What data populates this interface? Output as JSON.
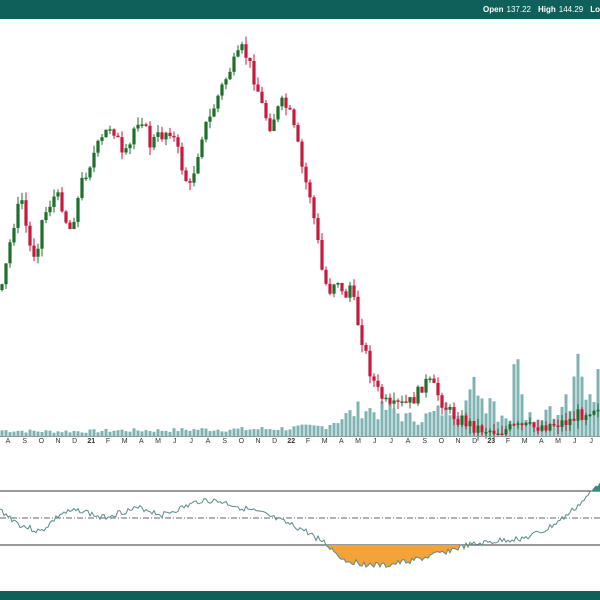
{
  "ohlc": {
    "open_label": "Open",
    "open_value": "137.22",
    "high_label": "High",
    "high_value": "144.29",
    "low_label": "Lo"
  },
  "colors": {
    "frame": "#0f5f5a",
    "up_candle": "#1e6f2a",
    "down_candle": "#c8193c",
    "volume": "#7fb3b3",
    "oscillator_line": "#5a8a8a",
    "overbought_fill": "#2f8c7e",
    "oversold_fill": "#f2a33a"
  },
  "chart_data": [
    {
      "type": "candlestick",
      "name": "price",
      "x_ticks": [
        "A",
        "S",
        "O",
        "N",
        "D",
        "21",
        "F",
        "M",
        "A",
        "M",
        "J",
        "J",
        "A",
        "S",
        "O",
        "N",
        "D",
        "22",
        "F",
        "M",
        "A",
        "M",
        "J",
        "J",
        "A",
        "S",
        "O",
        "N",
        "D",
        "23",
        "F",
        "M",
        "A",
        "M",
        "J",
        "J"
      ],
      "close_path": [
        [
          0,
          290
        ],
        [
          1,
          250
        ],
        [
          2,
          215
        ],
        [
          3,
          200
        ],
        [
          4,
          245
        ],
        [
          5,
          255
        ],
        [
          6,
          220
        ],
        [
          7,
          205
        ],
        [
          8,
          195
        ],
        [
          9,
          205
        ],
        [
          10,
          232
        ],
        [
          11,
          210
        ],
        [
          12,
          180
        ],
        [
          13,
          165
        ],
        [
          14,
          150
        ],
        [
          15,
          140
        ],
        [
          16,
          125
        ],
        [
          17,
          132
        ],
        [
          18,
          160
        ],
        [
          19,
          150
        ],
        [
          20,
          120
        ],
        [
          21,
          118
        ],
        [
          22,
          145
        ],
        [
          23,
          138
        ],
        [
          24,
          135
        ],
        [
          25,
          128
        ],
        [
          26,
          145
        ],
        [
          27,
          170
        ],
        [
          28,
          190
        ],
        [
          29,
          160
        ],
        [
          30,
          130
        ],
        [
          31,
          120
        ],
        [
          32,
          100
        ],
        [
          33,
          85
        ],
        [
          34,
          70
        ],
        [
          35,
          60
        ],
        [
          36,
          48
        ],
        [
          37,
          65
        ],
        [
          38,
          85
        ],
        [
          39,
          110
        ],
        [
          40,
          125
        ],
        [
          41,
          112
        ],
        [
          42,
          102
        ],
        [
          43,
          115
        ],
        [
          44,
          140
        ],
        [
          45,
          175
        ],
        [
          46,
          195
        ],
        [
          47,
          235
        ],
        [
          48,
          280
        ],
        [
          49,
          290
        ],
        [
          50,
          275
        ],
        [
          51,
          300
        ],
        [
          52,
          285
        ],
        [
          53,
          318
        ],
        [
          54,
          345
        ],
        [
          55,
          372
        ],
        [
          56,
          390
        ],
        [
          57,
          400
        ],
        [
          58,
          410
        ],
        [
          59,
          405
        ],
        [
          60,
          405
        ],
        [
          61,
          402
        ],
        [
          62,
          395
        ],
        [
          63,
          382
        ],
        [
          64,
          384
        ],
        [
          65,
          393
        ],
        [
          66,
          405
        ],
        [
          67,
          413
        ],
        [
          68,
          418
        ],
        [
          69,
          421
        ],
        [
          70,
          425
        ],
        [
          71,
          428
        ],
        [
          72,
          429
        ],
        [
          73,
          430
        ],
        [
          74,
          431
        ],
        [
          75,
          430
        ],
        [
          76,
          429
        ],
        [
          77,
          428
        ],
        [
          78,
          427
        ],
        [
          79,
          428
        ],
        [
          80,
          426
        ],
        [
          81,
          425
        ],
        [
          82,
          424
        ],
        [
          83,
          423
        ],
        [
          84,
          422
        ],
        [
          85,
          420
        ],
        [
          86,
          415
        ],
        [
          87,
          412
        ],
        [
          88,
          408
        ],
        [
          89,
          405
        ]
      ],
      "volume_path": [
        [
          0,
          6
        ],
        [
          6,
          5
        ],
        [
          12,
          5
        ],
        [
          18,
          6
        ],
        [
          24,
          6
        ],
        [
          30,
          7
        ],
        [
          36,
          7
        ],
        [
          42,
          8
        ],
        [
          48,
          10
        ],
        [
          51,
          20
        ],
        [
          54,
          30
        ],
        [
          56,
          25
        ],
        [
          58,
          30
        ],
        [
          60,
          20
        ],
        [
          62,
          18
        ],
        [
          64,
          22
        ],
        [
          66,
          28
        ],
        [
          68,
          30
        ],
        [
          70,
          40
        ],
        [
          71,
          60
        ],
        [
          72,
          30
        ],
        [
          73,
          50
        ],
        [
          74,
          22
        ],
        [
          75,
          25
        ],
        [
          76,
          18
        ],
        [
          77,
          115
        ],
        [
          78,
          28
        ],
        [
          79,
          22
        ],
        [
          80,
          18
        ],
        [
          81,
          26
        ],
        [
          82,
          35
        ],
        [
          83,
          18
        ],
        [
          84,
          40
        ],
        [
          85,
          28
        ],
        [
          86,
          75
        ],
        [
          87,
          45
        ],
        [
          88,
          50
        ],
        [
          89,
          55
        ]
      ]
    },
    {
      "type": "line",
      "name": "oscillator",
      "hlines": [
        "upper",
        "middle",
        "lower"
      ],
      "path": [
        [
          0,
          40
        ],
        [
          3,
          55
        ],
        [
          6,
          62
        ],
        [
          9,
          44
        ],
        [
          12,
          40
        ],
        [
          15,
          48
        ],
        [
          18,
          42
        ],
        [
          21,
          38
        ],
        [
          24,
          45
        ],
        [
          27,
          38
        ],
        [
          30,
          30
        ],
        [
          33,
          32
        ],
        [
          36,
          38
        ],
        [
          39,
          44
        ],
        [
          42,
          52
        ],
        [
          45,
          60
        ],
        [
          48,
          72
        ],
        [
          51,
          90
        ],
        [
          54,
          94
        ],
        [
          57,
          96
        ],
        [
          60,
          92
        ],
        [
          63,
          88
        ],
        [
          66,
          82
        ],
        [
          69,
          76
        ],
        [
          72,
          73
        ],
        [
          75,
          70
        ],
        [
          78,
          68
        ],
        [
          81,
          60
        ],
        [
          84,
          46
        ],
        [
          87,
          28
        ],
        [
          89,
          12
        ]
      ]
    }
  ]
}
